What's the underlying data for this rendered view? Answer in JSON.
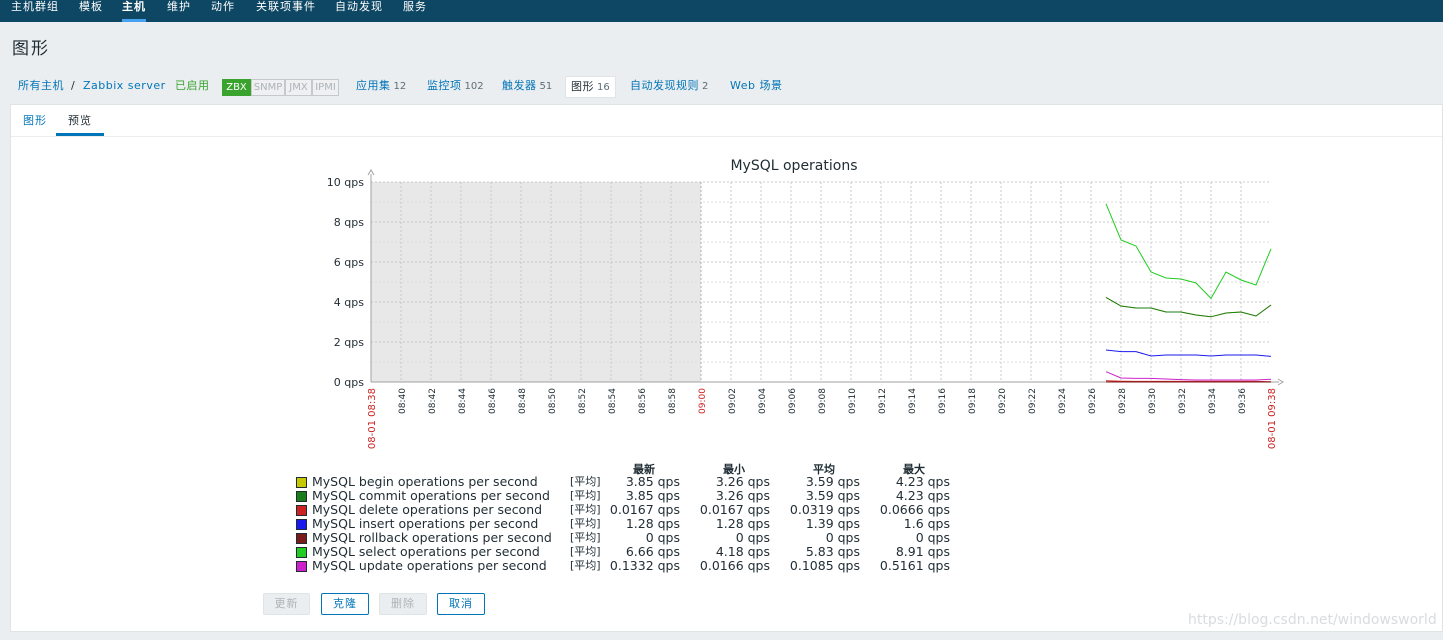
{
  "topnav": {
    "items": [
      {
        "label": "主机群组",
        "active": false
      },
      {
        "label": "模板",
        "active": false
      },
      {
        "label": "主机",
        "active": true
      },
      {
        "label": "维护",
        "active": false
      },
      {
        "label": "动作",
        "active": false
      },
      {
        "label": "关联项事件",
        "active": false
      },
      {
        "label": "自动发现",
        "active": false
      },
      {
        "label": "服务",
        "active": false
      }
    ]
  },
  "page": {
    "title": "图形"
  },
  "hostbar": {
    "all_hosts": "所有主机",
    "separator": "/",
    "host": "Zabbix server",
    "status": "已启用",
    "badges": {
      "zbx": "ZBX",
      "snmp": "SNMP",
      "jmx": "JMX",
      "ipmi": "IPMI"
    },
    "applications": {
      "label": "应用集",
      "count": "12"
    },
    "items": {
      "label": "监控项",
      "count": "102"
    },
    "triggers": {
      "label": "触发器",
      "count": "51"
    },
    "graphs": {
      "label": "图形",
      "count": "16"
    },
    "discovery": {
      "label": "自动发现规则",
      "count": "2"
    },
    "web": {
      "label": "Web 场景"
    }
  },
  "tabs": {
    "graph": "图形",
    "preview": "预览"
  },
  "chart_data": {
    "type": "line",
    "title": "MySQL operations",
    "ylim": [
      0,
      10
    ],
    "yticks": [
      "0 qps",
      "2 qps",
      "4 qps",
      "6 qps",
      "8 qps",
      "10 qps"
    ],
    "xlim": [
      "08:38",
      "09:38"
    ],
    "xticks": [
      "08:40",
      "08:42",
      "08:44",
      "08:46",
      "08:48",
      "08:50",
      "08:52",
      "08:54",
      "08:56",
      "08:58",
      "09:00",
      "09:02",
      "09:04",
      "09:06",
      "09:08",
      "09:10",
      "09:12",
      "09:14",
      "09:16",
      "09:18",
      "09:20",
      "09:22",
      "09:24",
      "09:26",
      "09:28",
      "09:30",
      "09:32",
      "09:34",
      "09:36"
    ],
    "x_start_label": "08-01 08:38",
    "x_end_label": "08-01 09:38",
    "nodata_until": "09:00",
    "x": [
      "09:27",
      "09:28",
      "09:29",
      "09:30",
      "09:31",
      "09:32",
      "09:33",
      "09:34",
      "09:35",
      "09:36",
      "09:37",
      "09:38"
    ],
    "series": [
      {
        "name": "MySQL begin operations per second",
        "color": "#c8c800",
        "values": [
          4.23,
          3.8,
          3.7,
          3.7,
          3.5,
          3.5,
          3.35,
          3.26,
          3.45,
          3.5,
          3.3,
          3.85
        ]
      },
      {
        "name": "MySQL commit operations per second",
        "color": "#1a7c1a",
        "values": [
          4.23,
          3.8,
          3.7,
          3.7,
          3.5,
          3.5,
          3.35,
          3.26,
          3.45,
          3.5,
          3.3,
          3.85
        ]
      },
      {
        "name": "MySQL delete operations per second",
        "color": "#cc2222",
        "values": [
          0.0666,
          0.04,
          0.03,
          0.03,
          0.03,
          0.03,
          0.03,
          0.03,
          0.03,
          0.03,
          0.03,
          0.0167
        ]
      },
      {
        "name": "MySQL insert operations per second",
        "color": "#1a1aee",
        "values": [
          1.6,
          1.52,
          1.52,
          1.3,
          1.35,
          1.35,
          1.35,
          1.3,
          1.35,
          1.35,
          1.35,
          1.28
        ]
      },
      {
        "name": "MySQL rollback operations per second",
        "color": "#7a1a1a",
        "values": [
          0,
          0,
          0,
          0,
          0,
          0,
          0,
          0,
          0,
          0,
          0,
          0
        ]
      },
      {
        "name": "MySQL select operations per second",
        "color": "#22cc22",
        "values": [
          8.91,
          7.1,
          6.8,
          5.5,
          5.2,
          5.15,
          4.95,
          4.18,
          5.5,
          5.1,
          4.85,
          6.66
        ]
      },
      {
        "name": "MySQL update operations per second",
        "color": "#cc22cc",
        "values": [
          0.5161,
          0.2,
          0.18,
          0.18,
          0.15,
          0.12,
          0.1,
          0.1,
          0.1,
          0.1,
          0.1,
          0.1332
        ]
      }
    ]
  },
  "legend": {
    "headers": [
      "最新",
      "最小",
      "平均",
      "最大"
    ],
    "func": "[平均]",
    "rows": [
      {
        "name": "MySQL begin operations per second",
        "color": "#c8c800",
        "last": "3.85 qps",
        "min": "3.26 qps",
        "avg": "3.59 qps",
        "max": "4.23 qps"
      },
      {
        "name": "MySQL commit operations per second",
        "color": "#1a7c1a",
        "last": "3.85 qps",
        "min": "3.26 qps",
        "avg": "3.59 qps",
        "max": "4.23 qps"
      },
      {
        "name": "MySQL delete operations per second",
        "color": "#cc2222",
        "last": "0.0167 qps",
        "min": "0.0167 qps",
        "avg": "0.0319 qps",
        "max": "0.0666 qps"
      },
      {
        "name": "MySQL insert operations per second",
        "color": "#1a1aee",
        "last": "1.28 qps",
        "min": "1.28 qps",
        "avg": "1.39 qps",
        "max": "1.6 qps"
      },
      {
        "name": "MySQL rollback operations per second",
        "color": "#7a1a1a",
        "last": "0 qps",
        "min": "0 qps",
        "avg": "0 qps",
        "max": "0 qps"
      },
      {
        "name": "MySQL select operations per second",
        "color": "#22cc22",
        "last": "6.66 qps",
        "min": "4.18 qps",
        "avg": "5.83 qps",
        "max": "8.91 qps"
      },
      {
        "name": "MySQL update operations per second",
        "color": "#cc22cc",
        "last": "0.1332 qps",
        "min": "0.0166 qps",
        "avg": "0.1085 qps",
        "max": "0.5161 qps"
      }
    ]
  },
  "buttons": {
    "update": "更新",
    "clone": "克隆",
    "delete": "删除",
    "cancel": "取消"
  },
  "watermark": "https://blog.csdn.net/windowsworld"
}
